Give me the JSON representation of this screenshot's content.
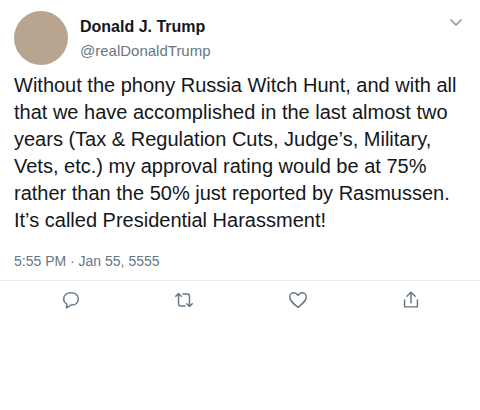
{
  "tweet": {
    "author": {
      "name": "Donald J. Trump",
      "handle": "@realDonaldTrump"
    },
    "text": "Without the phony Russia Witch Hunt, and with all that we have accomplished in the last almost two years (Tax & Regulation Cuts, Judge’s, Military, Vets, etc.) my approval rating would be at 75% rather than the 50% just reported by Rasmussen. It’s called Presidential Harassment!",
    "timestamp": "5:55 PM · Jan 55, 5555"
  }
}
